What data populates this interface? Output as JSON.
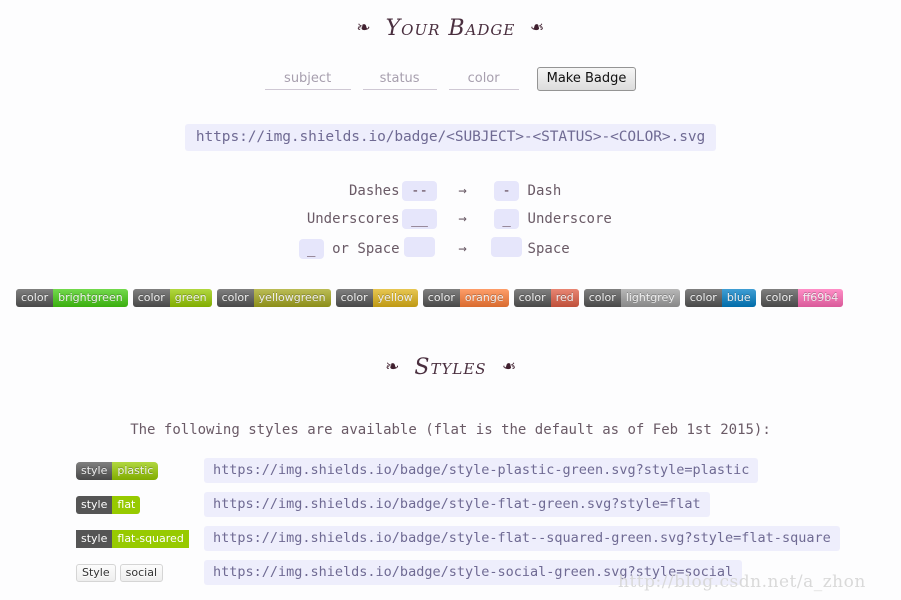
{
  "headings": {
    "your_badge": "Your Badge",
    "styles": "Styles",
    "ornament_left": "❧",
    "ornament_right": "❧"
  },
  "form": {
    "subject_placeholder": "subject",
    "subject_value": "",
    "status_placeholder": "status",
    "status_value": "",
    "color_placeholder": "color",
    "color_value": "",
    "make_badge_label": "Make Badge"
  },
  "url_template": "https://img.shields.io/badge/<SUBJECT>-<STATUS>-<COLOR>.svg",
  "separators": [
    {
      "label": "Dashes",
      "chip": "--",
      "arrow": "→",
      "result_chip": "-",
      "result_name": "Dash"
    },
    {
      "label": "Underscores",
      "chip": "__",
      "arrow": "→",
      "result_chip": "_",
      "result_name": "Underscore"
    },
    {
      "label": "_ or Space",
      "chip": "",
      "arrow": "→",
      "result_chip": "",
      "result_name": "Space"
    }
  ],
  "separator_inline_chip": "_",
  "separator_inline_rest": " or Space",
  "colors": {
    "label": "color",
    "grey": "#555555",
    "items": [
      {
        "name": "brightgreen",
        "hex": "#4c1"
      },
      {
        "name": "green",
        "hex": "#97ca00"
      },
      {
        "name": "yellowgreen",
        "hex": "#a4a61d"
      },
      {
        "name": "yellow",
        "hex": "#dfb317"
      },
      {
        "name": "orange",
        "hex": "#fe7d37"
      },
      {
        "name": "red",
        "hex": "#e05d44"
      },
      {
        "name": "lightgrey",
        "hex": "#9f9f9f"
      },
      {
        "name": "blue",
        "hex": "#007ec6"
      },
      {
        "name": "ff69b4",
        "hex": "#ff69b4"
      }
    ]
  },
  "styles_section": {
    "description": "The following styles are available (flat is the default as of Feb 1st 2015):",
    "rows": [
      {
        "badge_left": "style",
        "badge_right": "plastic",
        "badge_color": "#97ca00",
        "variant": "plastic",
        "url": "https://img.shields.io/badge/style-plastic-green.svg?style=plastic"
      },
      {
        "badge_left": "style",
        "badge_right": "flat",
        "badge_color": "#97ca00",
        "variant": "flat",
        "url": "https://img.shields.io/badge/style-flat-green.svg?style=flat"
      },
      {
        "badge_left": "style",
        "badge_right": "flat-squared",
        "badge_color": "#97ca00",
        "variant": "flatsq",
        "url": "https://img.shields.io/badge/style-flat--squared-green.svg?style=flat-square"
      },
      {
        "badge_left": "Style",
        "badge_right": "social",
        "badge_color": "#ffffff",
        "variant": "social",
        "url": "https://img.shields.io/badge/style-social-green.svg?style=social"
      }
    ]
  },
  "watermark": "http://blog.csdn.net/a_zhon"
}
